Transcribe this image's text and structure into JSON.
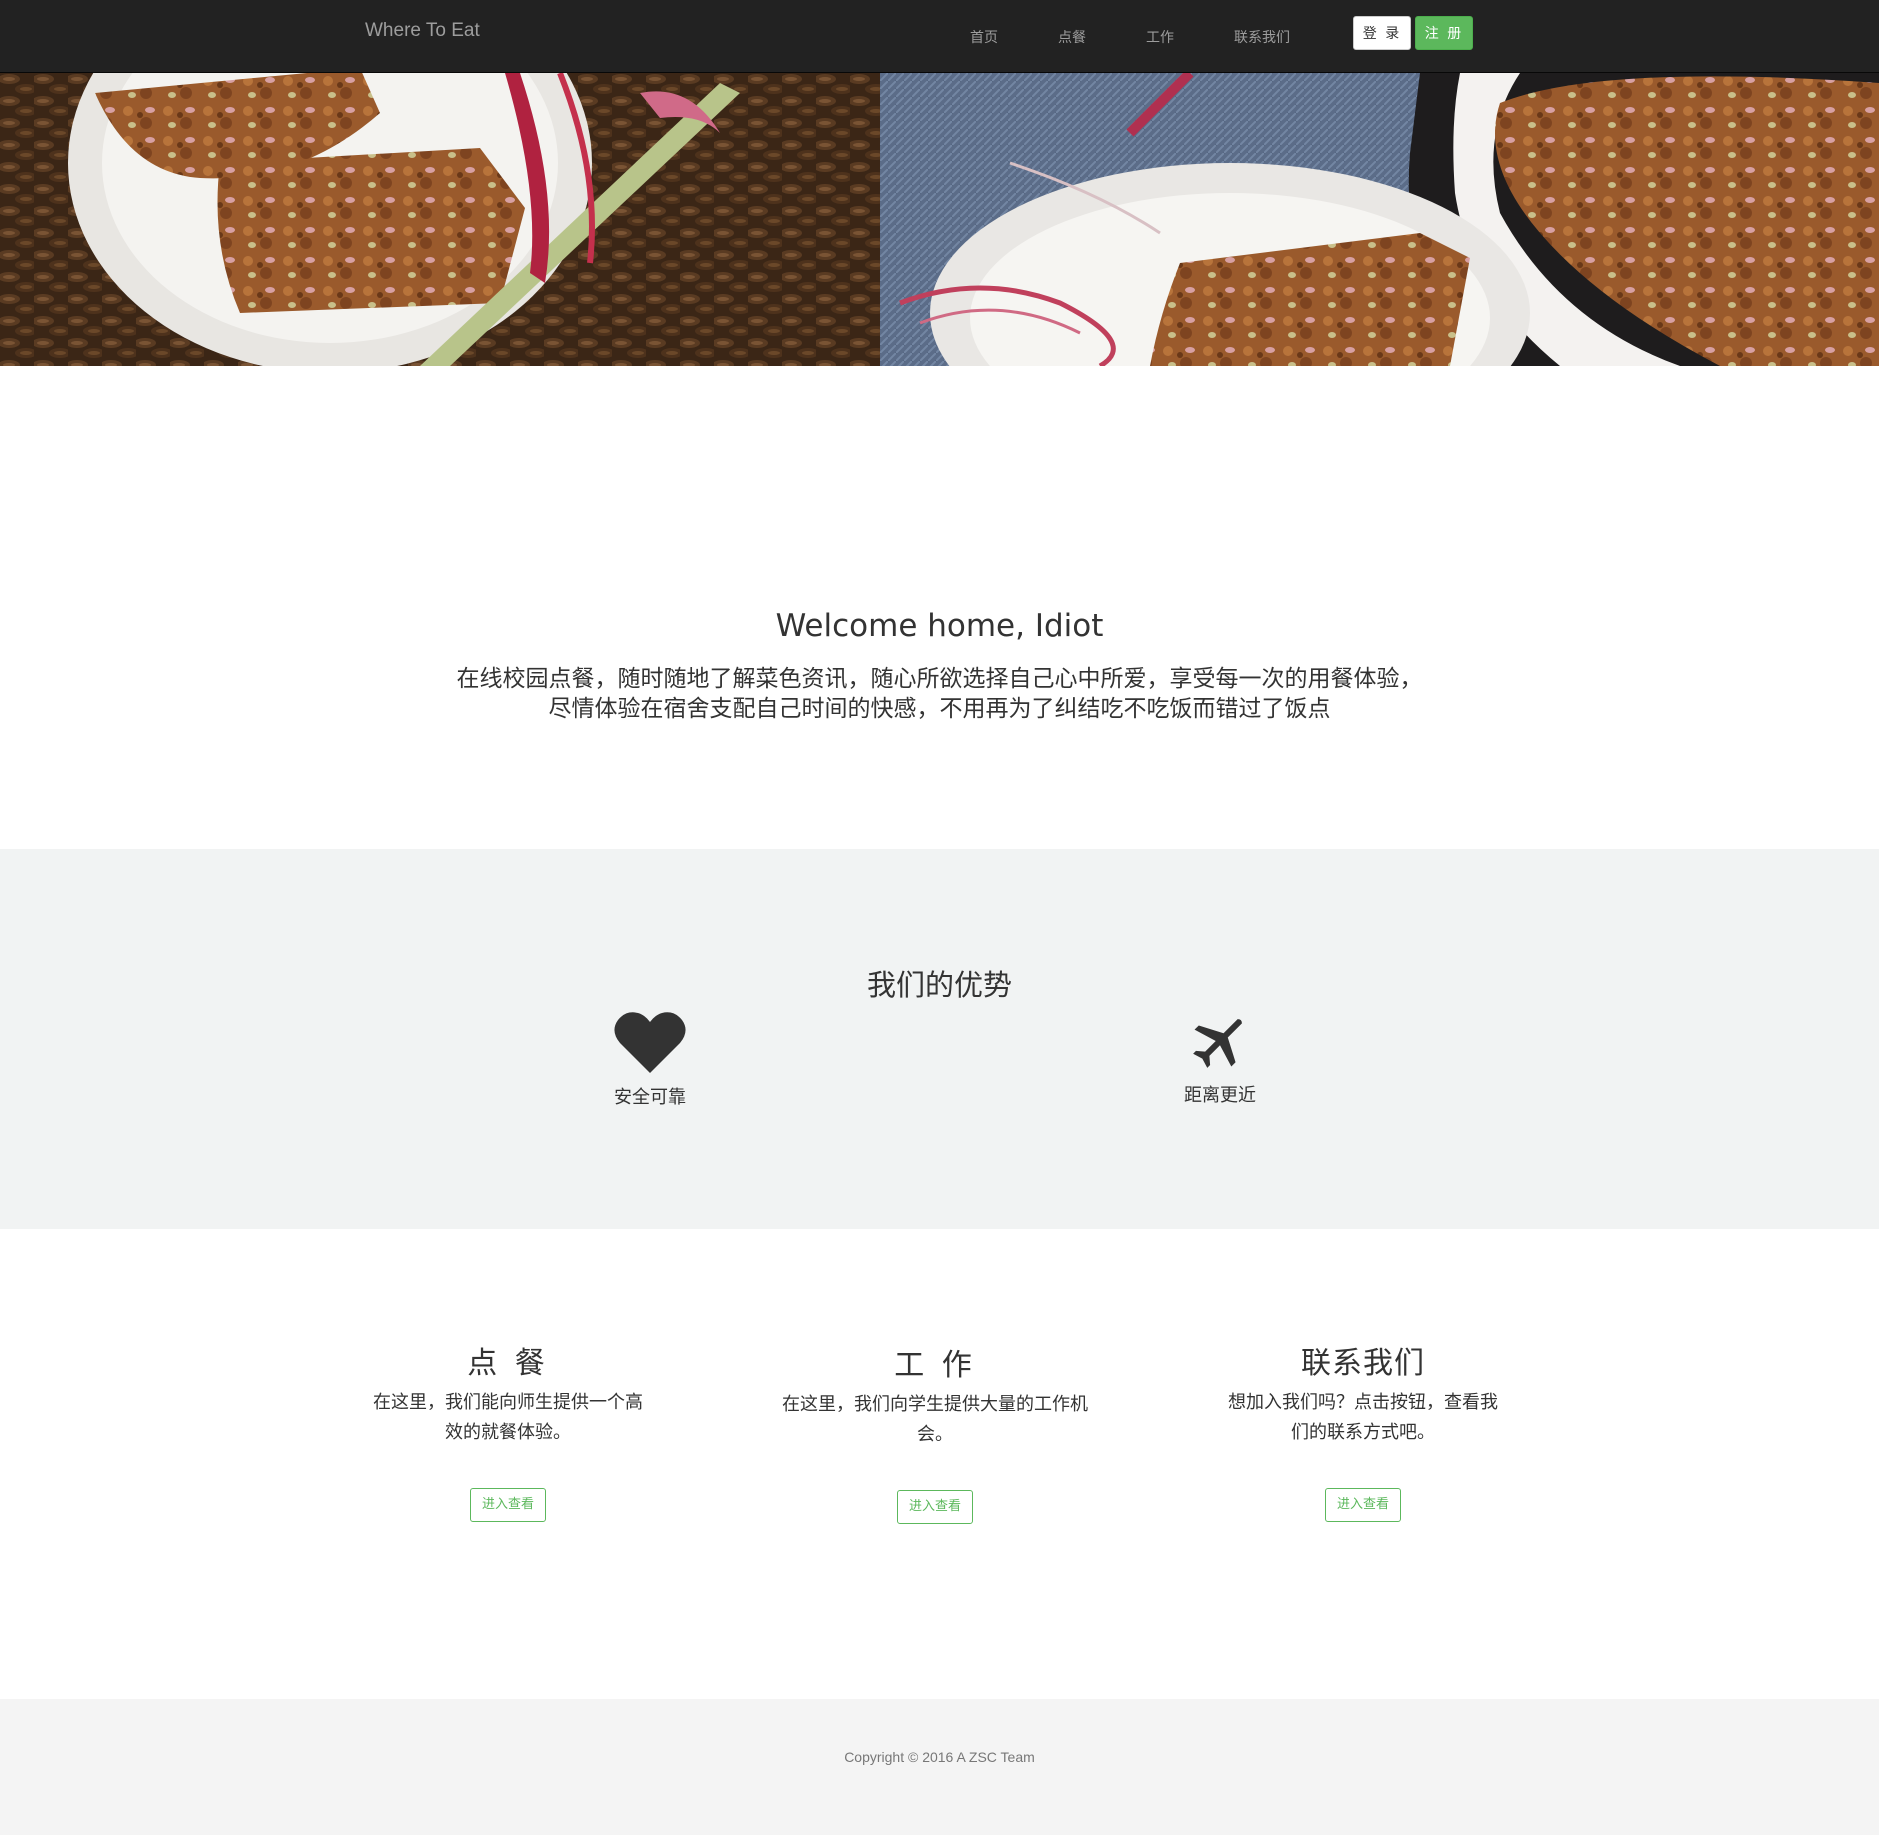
{
  "navbar": {
    "brand": "Where To Eat",
    "links": [
      "首页",
      "点餐",
      "工作",
      "联系我们"
    ],
    "login_label": "登 录",
    "register_label": "注 册"
  },
  "hero": {
    "image_subject": "rhubarb-cake-photo"
  },
  "welcome": {
    "title": "Welcome home, Idiot",
    "description": "在线校园点餐，随时随地了解菜色资讯，随心所欲选择自己心中所爱，享受每一次的用餐体验，尽情体验在宿舍支配自己时间的快感，不用再为了纠结吃不吃饭而错过了饭点"
  },
  "advantages": {
    "title": "我们的优势",
    "items": [
      {
        "icon": "heart-icon",
        "label": "安全可靠"
      },
      {
        "icon": "airplane-icon",
        "label": "距离更近"
      }
    ]
  },
  "services": [
    {
      "title": "点 餐",
      "description": "在这里，我们能向师生提供一个高效的就餐体验。",
      "button": "进入查看"
    },
    {
      "title": "工 作",
      "description": "在这里，我们向学生提供大量的工作机会。",
      "button": "进入查看"
    },
    {
      "title": "联系我们",
      "description": "想加入我们吗？点击按钮，查看我们的联系方式吧。",
      "button": "进入查看"
    }
  ],
  "footer": {
    "copyright": "Copyright © 2016 A ZSC Team"
  },
  "colors": {
    "navbar_bg": "#222222",
    "accent_green": "#5cb85c",
    "advantages_bg": "#f1f3f3",
    "footer_bg": "#f4f4f4"
  }
}
